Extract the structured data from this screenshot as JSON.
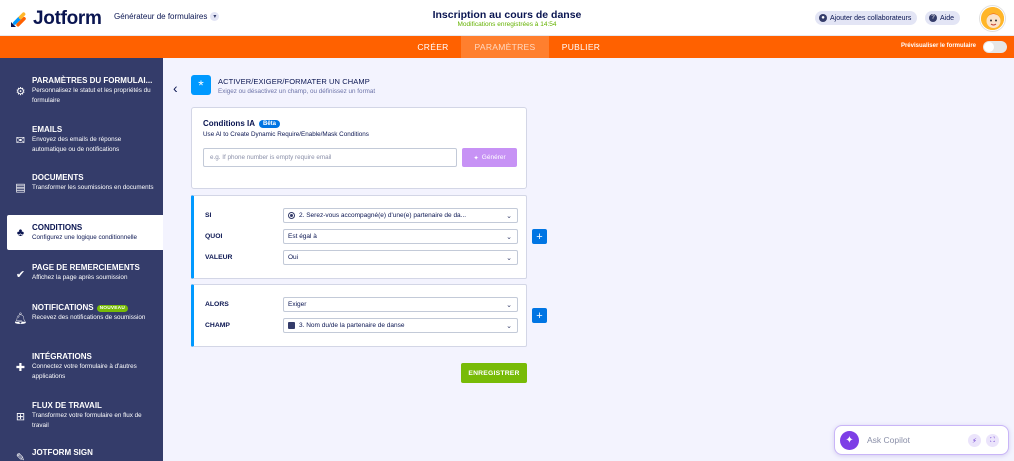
{
  "header": {
    "brand": "Jotform",
    "generator": "Générateur de formulaires",
    "form_title": "Inscription au cours de danse",
    "saved_status": "Modifications enregistrées à 14:54",
    "add_collaborators": "Ajouter des collaborateurs",
    "help": "Aide"
  },
  "nav": {
    "tabs": [
      {
        "label": "CRÉER"
      },
      {
        "label": "PARAMÈTRES"
      },
      {
        "label": "PUBLIER"
      }
    ],
    "preview_label": "Prévisualiser le formulaire"
  },
  "sidebar": {
    "items": [
      {
        "title": "PARAMÈTRES DU FORMULAI...",
        "desc": "Personnalisez le statut et les propriétés du formulaire",
        "icon": "gear-icon"
      },
      {
        "title": "EMAILS",
        "desc": "Envoyez des emails de réponse automatique ou de notifications",
        "icon": "envelope-icon"
      },
      {
        "title": "DOCUMENTS",
        "desc": "Transformer les soumissions en documents",
        "icon": "document-icon"
      },
      {
        "title": "CONDITIONS",
        "desc": "Configurez une logique conditionnelle",
        "icon": "conditions-icon"
      },
      {
        "title": "PAGE DE REMERCIEMENTS",
        "desc": "Affichez la page après soumission",
        "icon": "check-icon"
      },
      {
        "title": "NOTIFICATIONS",
        "badge": "NOUVEAU",
        "desc": "Recevez des notifications de soumission",
        "icon": "bell-icon"
      },
      {
        "title": "INTÉGRATIONS",
        "desc": "Connectez votre formulaire à d'autres applications",
        "icon": "puzzle-icon"
      },
      {
        "title": "FLUX DE TRAVAIL",
        "desc": "Transformez votre formulaire en flux de travail",
        "icon": "workflow-icon"
      },
      {
        "title": "JOTFORM SIGN",
        "desc": "",
        "icon": "sign-icon"
      }
    ]
  },
  "section": {
    "title": "ACTIVER/EXIGER/FORMATER UN CHAMP",
    "subtitle": "Exigez ou désactivez un champ, ou définissez un format"
  },
  "ai": {
    "title": "Conditions IA",
    "badge": "Bêta",
    "subtitle": "Use AI to Create Dynamic Require/Enable/Mask Conditions",
    "placeholder": "e.g. If phone number is empty require email",
    "button": "Générer"
  },
  "condition": {
    "if_label": "SI",
    "if_value": "2. Serez-vous accompagné(e) d'une(e) partenaire de da...",
    "what_label": "QUOI",
    "what_value": "Est égal à",
    "value_label": "VALEUR",
    "value_value": "Oui"
  },
  "action": {
    "then_label": "ALORS",
    "then_value": "Exiger",
    "field_label": "CHAMP",
    "field_value": "3. Nom du/de la partenaire de danse"
  },
  "save_button": "ENREGISTRER",
  "copilot": {
    "placeholder": "Ask Copilot"
  },
  "colors": {
    "brand_orange": "#ff6100",
    "sidebar": "#343c6a",
    "accent_blue": "#0099ff",
    "save_green": "#78bb07",
    "ai_purple": "#c792f5"
  }
}
